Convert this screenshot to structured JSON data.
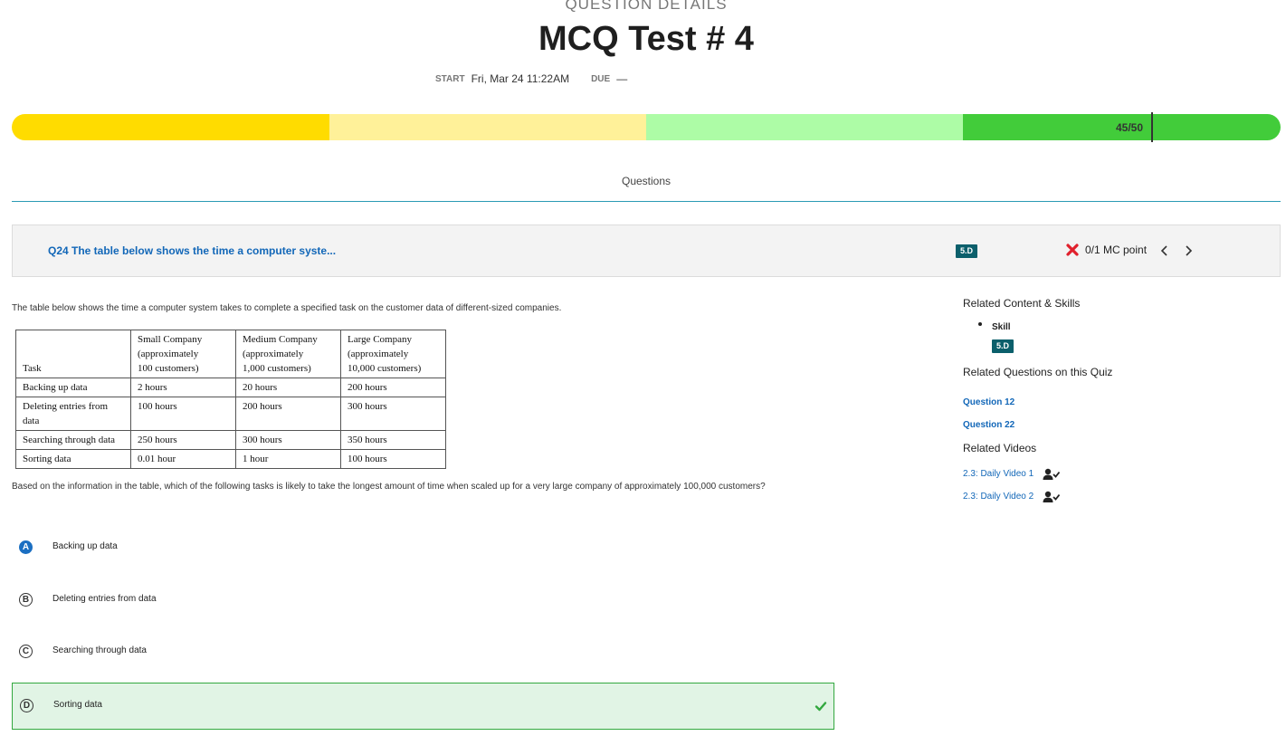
{
  "header": {
    "eyebrow": "QUESTION DETAILS",
    "title": "MCQ Test # 4",
    "start_label": "START",
    "start_value": "Fri, Mar 24 11:22AM",
    "due_label": "DUE",
    "due_value": "—"
  },
  "score_bar": {
    "text": "45/50",
    "score": 45,
    "max": 50,
    "segment_colors": [
      "#ffdc00",
      "#fff199",
      "#adfca6",
      "#42cc3a"
    ]
  },
  "tabs": {
    "active": "Questions"
  },
  "question_header": {
    "link_text": "Q24 The table below shows the time a computer syste...",
    "skill_badge": "5.D",
    "result_icon": "x-mark-icon",
    "result_color": "#e0202c",
    "points": "0/1 MC point"
  },
  "question": {
    "prompt": "The table below shows the time a computer system takes to complete a specified task on the customer data of different-sized companies.",
    "table": {
      "headers": [
        "Task",
        "Small Company (approximately 100 customers)",
        "Medium Company (approximately 1,000 customers)",
        "Large Company (approximately 10,000 customers)"
      ],
      "header_lines": [
        [
          "Task"
        ],
        [
          "Small Company",
          "(approximately",
          "100 customers)"
        ],
        [
          "Medium Company",
          "(approximately",
          "1,000 customers)"
        ],
        [
          "Large Company",
          "(approximately",
          "10,000 customers)"
        ]
      ],
      "rows": [
        [
          "Backing up data",
          "2 hours",
          "20 hours",
          "200 hours"
        ],
        [
          "Deleting entries from data",
          "100 hours",
          "200 hours",
          "300 hours"
        ],
        [
          "Searching through data",
          "250 hours",
          "300 hours",
          "350 hours"
        ],
        [
          "Sorting data",
          "0.01 hour",
          "1 hour",
          "100 hours"
        ]
      ]
    },
    "stem": "Based on the information in the table, which of the following tasks is likely to take the longest amount of time when scaled up for a very large company of approximately 100,000 customers?",
    "choices": [
      {
        "letter": "A",
        "text": "Backing up data",
        "selected": true
      },
      {
        "letter": "B",
        "text": "Deleting entries from data",
        "selected": false
      },
      {
        "letter": "C",
        "text": "Searching through data",
        "selected": false
      },
      {
        "letter": "D",
        "text": "Sorting data",
        "correct": true
      }
    ]
  },
  "sidebar": {
    "related_heading": "Related Content & Skills",
    "skill_label": "Skill",
    "skill_badge": "5.D",
    "related_questions_heading": "Related Questions on this Quiz",
    "related_questions": [
      "Question 12",
      "Question 22"
    ],
    "videos_heading": "Related Videos",
    "videos": [
      {
        "title": "2.3: Daily Video 1",
        "icon": "person-check-icon"
      },
      {
        "title": "2.3: Daily Video 2",
        "icon": "person-check-icon"
      }
    ]
  },
  "colors": {
    "link": "#1267b8",
    "badge": "#0b5f6b",
    "correct_bg": "#e1f4e5",
    "correct_border": "#33a83f",
    "selected_choice": "#1b6fc2"
  }
}
